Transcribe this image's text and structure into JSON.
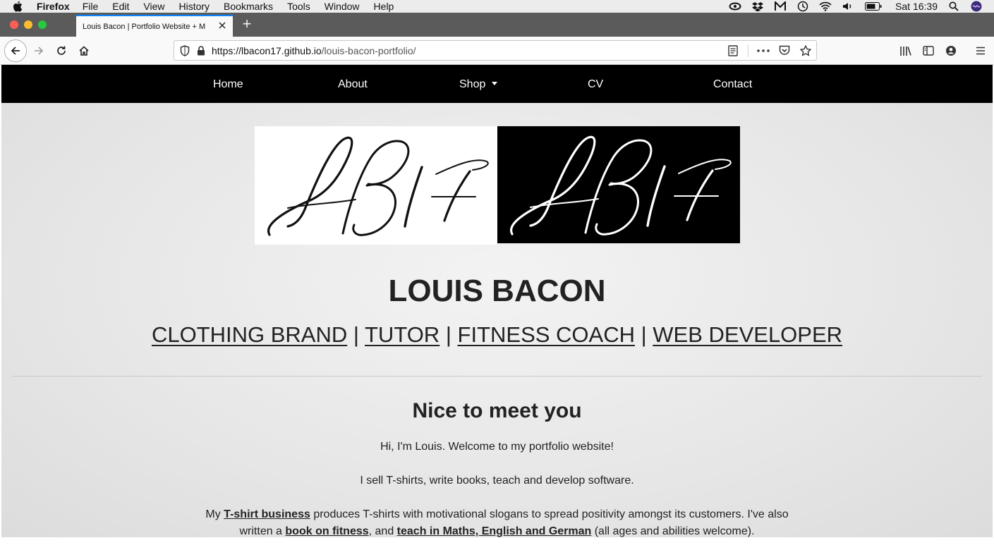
{
  "menubar": {
    "app": "Firefox",
    "items": [
      "File",
      "Edit",
      "View",
      "History",
      "Bookmarks",
      "Tools",
      "Window",
      "Help"
    ],
    "clock": "Sat 16:39"
  },
  "browser": {
    "tab_title": "Louis Bacon | Portfolio Website + M",
    "url_host": "https://lbacon17.github.io",
    "url_path": "/louis-bacon-portfolio/"
  },
  "site": {
    "nav": {
      "home": "Home",
      "about": "About",
      "shop": "Shop",
      "cv": "CV",
      "contact": "Contact"
    },
    "logo_text": "LB17",
    "name": "LOUIS BACON",
    "roles": [
      "CLOTHING BRAND",
      "TUTOR",
      "FITNESS COACH",
      "WEB DEVELOPER"
    ],
    "role_separator": "|",
    "heading": "Nice to meet you",
    "intro": "Hi, I'm Louis. Welcome to my portfolio website!",
    "summary": "I sell T-shirts, write books, teach and develop software.",
    "p3": {
      "t1": "My ",
      "link1": "T-shirt business",
      "t2": " produces T-shirts with motivational slogans to spread positivity amongst its customers. I've also",
      "t3": "written a ",
      "link2": "book on fitness",
      "t4": ", and ",
      "link3": "teach in Maths, English and German",
      "t5": " (all ages and abilities welcome)."
    }
  }
}
